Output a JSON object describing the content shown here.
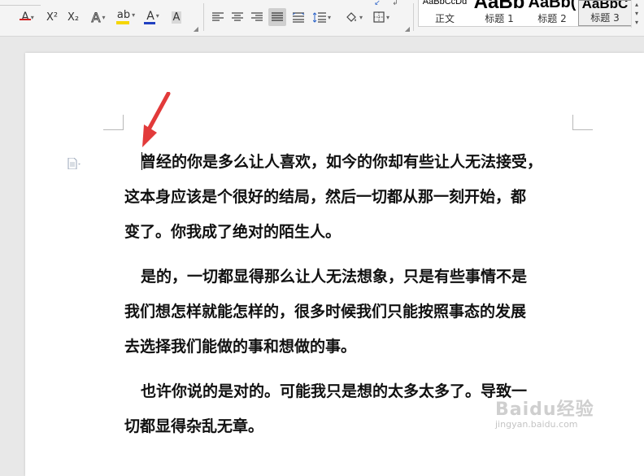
{
  "toolbar": {
    "strikethrough_icon": "A",
    "superscript_icon": "X²",
    "subscript_icon": "X₂",
    "text_effect_icon": "A",
    "highlight_icon": "ab",
    "font_color_icon": "A",
    "char_shading_icon": "A",
    "accent_highlight": "#f5d600",
    "accent_font_color": "#2040c0",
    "accent_strike": "#d02020"
  },
  "styles": [
    {
      "preview": "AaBbCcDd",
      "name": "正文"
    },
    {
      "preview": "AaBb",
      "name": "标题 1"
    },
    {
      "preview": "AaBb(",
      "name": "标题 2"
    },
    {
      "preview": "AaBbC",
      "name": "标题 3"
    }
  ],
  "document": {
    "paragraphs": [
      {
        "lines": [
          "曾经的你是多么让人喜欢，如今的你却有些让人无法接受，",
          "这本身应该是个很好的结局，然后一切都从那一刻开始，都",
          "变了。你我成了绝对的陌生人。"
        ]
      },
      {
        "lines": [
          "是的，一切都显得那么让人无法想象，只是有些事情不是",
          "我们想怎样就能怎样的，很多时候我们只能按照事态的发展",
          "去选择我们能做的事和想做的事。"
        ]
      },
      {
        "lines": [
          "也许你说的是对的。可能我只是想的太多太多了。导致一",
          "切都显得杂乱无章。"
        ]
      }
    ]
  },
  "watermark": {
    "text": "Baidu经验",
    "url": "jingyan.baidu.com"
  },
  "icons": {
    "paragraph_handle": "document-icon",
    "annotation": "red-arrow-icon"
  }
}
